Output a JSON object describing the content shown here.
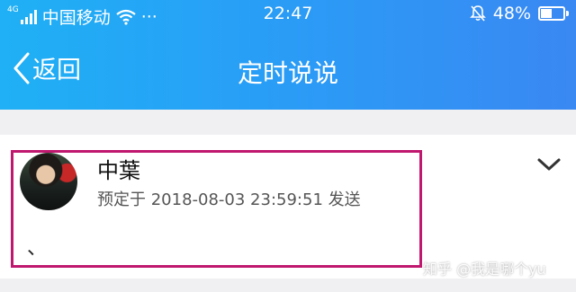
{
  "status_bar": {
    "signal_label": "4G",
    "carrier": "中国移动",
    "dots": "···",
    "time": "22:47",
    "battery": "48%",
    "battery_level": 0.48
  },
  "nav": {
    "back_label": "返回",
    "title": "定时说说"
  },
  "post": {
    "author": "中葉",
    "schedule": "预定于 2018-08-03 23:59:51 发送",
    "content": "、"
  },
  "watermark": "知乎 @我是哪个yu",
  "colors": {
    "header_start": "#1fb0f5",
    "header_end": "#3a88f2",
    "highlight_border": "#c0186f"
  }
}
